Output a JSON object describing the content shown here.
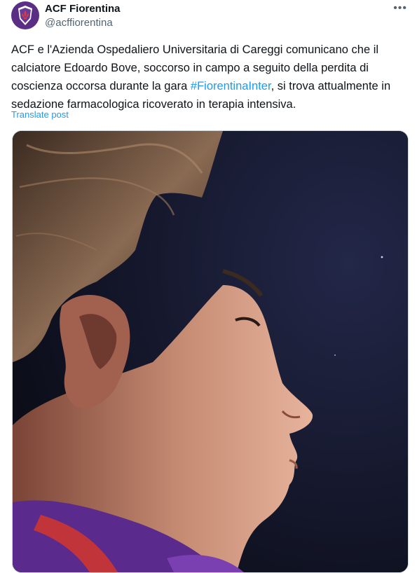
{
  "post": {
    "author_name": "ACF Fiorentina",
    "author_handle": "@acffiorentina",
    "more_glyph": "•••",
    "text_before": "ACF e l'Azienda Ospedaliero Universitaria di Careggi comunicano che il calciatore Edoardo Bove, soccorso in campo a seguito della perdita di coscienza occorsa durante la gara ",
    "hashtag": "#FiorentinaInter",
    "text_after": ", si trova attualmente in sedazione farmacologica ricoverato in terapia intensiva.",
    "translate_label": "Translate post"
  },
  "colors": {
    "brand_purple": "#5b2e86",
    "link_blue": "#1d9bf0",
    "muted_gray": "#536471"
  },
  "icons": {
    "avatar": "fiorentina-lily-logo",
    "more": "more-horizontal-icon"
  }
}
